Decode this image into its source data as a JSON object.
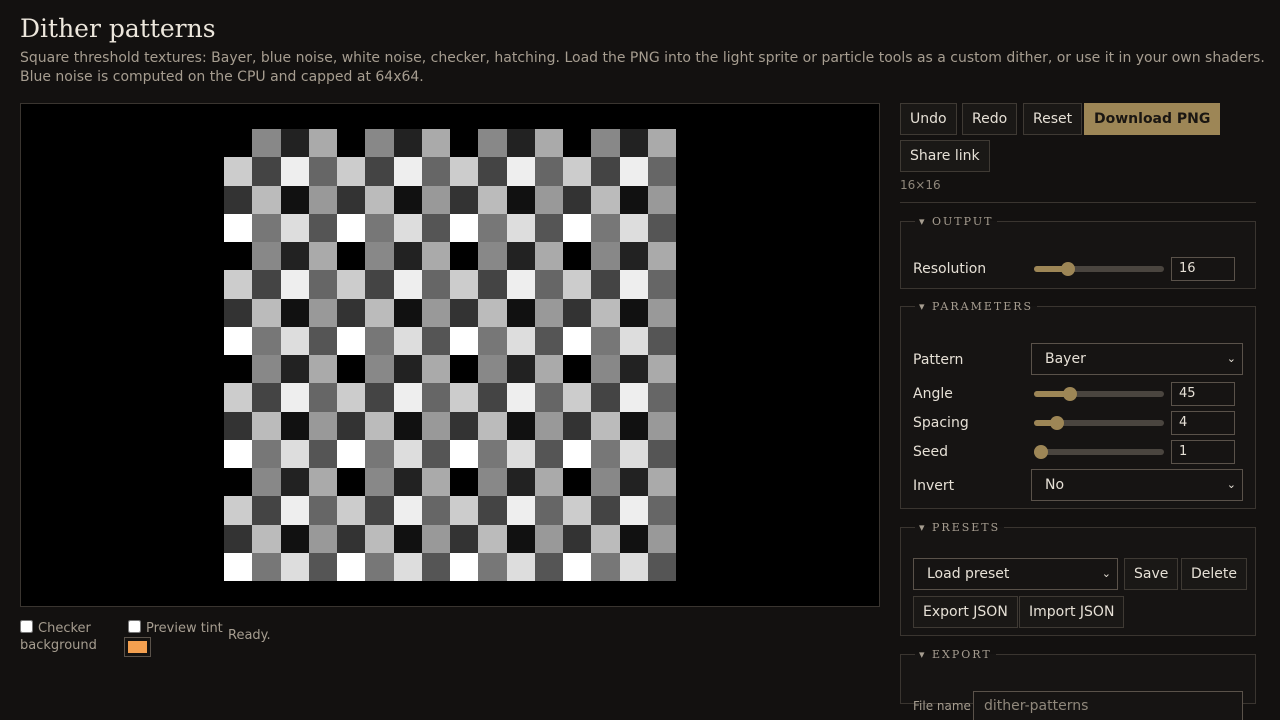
{
  "page": {
    "title": "Dither patterns",
    "description": "Square threshold textures: Bayer, blue noise, white noise, checker, hatching. Load the PNG into the light sprite or particle tools as a custom dither, or use it in your own shaders. Blue noise is computed on the CPU and capped at 64x64."
  },
  "preview": {
    "pattern_grid": {
      "size": 16,
      "bayer4_gray_levels": [
        [
          0,
          136,
          34,
          170
        ],
        [
          204,
          68,
          238,
          102
        ],
        [
          51,
          187,
          17,
          153
        ],
        [
          255,
          119,
          221,
          85
        ]
      ]
    },
    "checker_background_label": "Checker background",
    "preview_tint_label": "Preview tint",
    "tint_color": "#f4a050",
    "status": "Ready."
  },
  "toolbar": {
    "undo": "Undo",
    "redo": "Redo",
    "reset": "Reset",
    "download": "Download PNG",
    "share": "Share link",
    "dimensions": "16×16"
  },
  "output": {
    "legend": "▾ OUTPUT",
    "resolution_label": "Resolution",
    "resolution_value": "16",
    "resolution_fraction": 0.26
  },
  "parameters": {
    "legend": "▾ PARAMETERS",
    "pattern_label": "Pattern",
    "pattern_value": "Bayer",
    "angle_label": "Angle",
    "angle_value": "45",
    "angle_fraction": 0.28,
    "spacing_label": "Spacing",
    "spacing_value": "4",
    "spacing_fraction": 0.18,
    "seed_label": "Seed",
    "seed_value": "1",
    "seed_fraction": 0.0,
    "invert_label": "Invert",
    "invert_value": "No"
  },
  "presets": {
    "legend": "▾ PRESETS",
    "load_value": "Load preset",
    "save": "Save",
    "delete": "Delete",
    "export_json": "Export JSON",
    "import_json": "Import JSON"
  },
  "export": {
    "legend": "▾ EXPORT",
    "file_name_label": "File name",
    "file_name_placeholder": "dither-patterns"
  },
  "colors": {
    "accent": "#9d8656",
    "background": "#131110"
  },
  "icons": {
    "select_chevron": "chevron-down-icon",
    "legend_toggle": "triangle-down-icon"
  }
}
